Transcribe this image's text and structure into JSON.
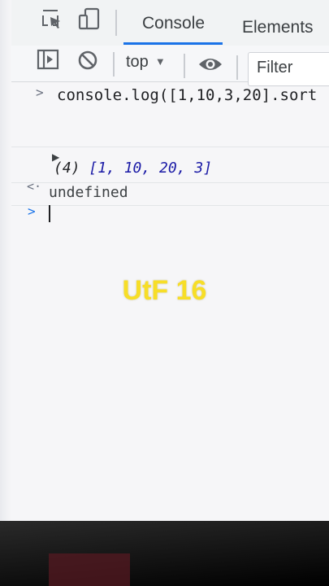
{
  "tabs": {
    "console": "Console",
    "elements": "Elements"
  },
  "toolbar": {
    "context": "top",
    "filter_placeholder": "Filter"
  },
  "console": {
    "input_line": "console.log([1,10,3,20].sort",
    "result_count": "(4)",
    "result_array": "[1, 10, 20, 3]",
    "return_value": "undefined"
  },
  "overlay": {
    "caption": "UtF 16"
  },
  "colors": {
    "active_tab": "#1a73e8",
    "number": "#1a1aa6",
    "caption": "#f7de27"
  }
}
